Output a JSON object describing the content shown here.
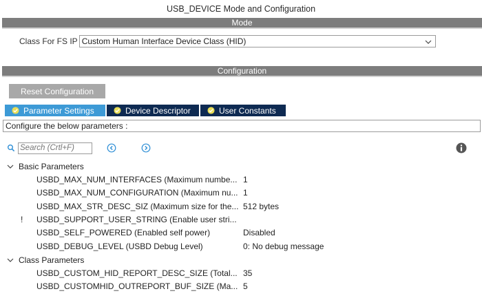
{
  "window": {
    "title": "USB_DEVICE Mode and Configuration"
  },
  "mode_section": {
    "header": "Mode",
    "class_label": "Class For FS IP",
    "class_value": "Custom Human Interface Device Class (HID)"
  },
  "config_section": {
    "header": "Configuration",
    "reset_label": "Reset Configuration",
    "tabs": [
      {
        "label": "Parameter Settings",
        "active": true
      },
      {
        "label": "Device Descriptor",
        "active": false
      },
      {
        "label": "User Constants",
        "active": false
      }
    ],
    "description": "Configure the below parameters :",
    "search": {
      "placeholder": "Search (Crtl+F)"
    }
  },
  "groups": {
    "basic": {
      "label": "Basic Parameters",
      "params": [
        {
          "name": "USBD_MAX_NUM_INTERFACES (Maximum number of interfaces)",
          "value": "1",
          "warning": ""
        },
        {
          "name": "USBD_MAX_NUM_CONFIGURATION (Maximum number of configuration)",
          "value": "1",
          "warning": ""
        },
        {
          "name": "USBD_MAX_STR_DESC_SIZ (Maximum size for the string descriptors)",
          "value": "512 bytes",
          "warning": ""
        },
        {
          "name": "USBD_SUPPORT_USER_STRING (Enable user string descriptor)",
          "value": "",
          "warning": "!"
        },
        {
          "name": "USBD_SELF_POWERED (Enabled self power)",
          "value": "Disabled",
          "warning": ""
        },
        {
          "name": "USBD_DEBUG_LEVEL (USBD Debug Level)",
          "value": "0: No debug message",
          "warning": ""
        }
      ]
    },
    "class": {
      "label": "Class Parameters",
      "params": [
        {
          "name": "USBD_CUSTOM_HID_REPORT_DESC_SIZE (Total length for the report descriptor)",
          "value": "35",
          "warning": ""
        },
        {
          "name": "USBD_CUSTOMHID_OUTREPORT_BUF_SIZE (Maximum size for the out report buffer)",
          "value": "5",
          "warning": ""
        }
      ]
    }
  },
  "colors": {
    "section_bar": "#7d7d7d",
    "tab_active": "#3d9ad6",
    "tab_inactive": "#0e2a52",
    "check_yellow": "#e8dd57",
    "accent_blue": "#2f8fd6"
  }
}
